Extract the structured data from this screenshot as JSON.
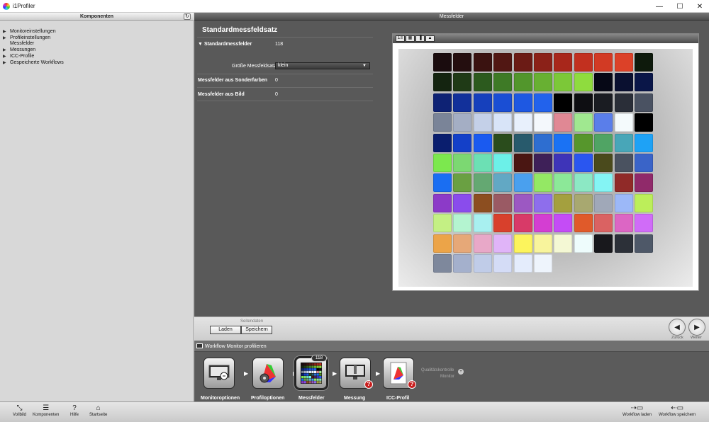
{
  "window": {
    "title": "i1Profiler",
    "minimize": "—",
    "maximize": "☐",
    "close": "✕"
  },
  "left_panel": {
    "header": "Komponenten",
    "refresh_glyph": "↻",
    "items": [
      {
        "label": "Monitoreinstellungen",
        "expandable": true
      },
      {
        "label": "Profileinstellungen",
        "expandable": true
      },
      {
        "label": "Messfelder",
        "expandable": false
      },
      {
        "label": "Messungen",
        "expandable": true
      },
      {
        "label": "ICC-Profile",
        "expandable": true
      },
      {
        "label": "Gespeicherte Workflows",
        "expandable": true
      }
    ]
  },
  "center": {
    "title": "Messfelder",
    "section_title": "Standardmessfeldsatz",
    "standard_label": "Standardmessfelder",
    "standard_value": "118",
    "size_label": "Größe Messfeldsatz:",
    "size_value": "klein",
    "spot_label": "Messfelder aus Sonderfarben",
    "spot_value": "0",
    "image_label": "Messfelder aus Bild",
    "image_value": "0"
  },
  "preview_toolbar": [
    "Σ≡",
    "▦",
    "▐",
    "▲"
  ],
  "patches": [
    "#1a0c0e",
    "#240e0f",
    "#3a1210",
    "#511713",
    "#6b1b15",
    "#8b2118",
    "#a8271b",
    "#c2301f",
    "#d23a24",
    "#dc4128",
    "#0e1a0c",
    "#142410",
    "#1f3a16",
    "#2c5a1e",
    "#3e7a26",
    "#52962c",
    "#68b032",
    "#7cc838",
    "#8fdc3e",
    "#060816",
    "#0a1030",
    "#0a1648",
    "#0e2274",
    "#12309a",
    "#1640bc",
    "#1a4ed4",
    "#1e58e2",
    "#2262ec",
    "#000000",
    "#0e0e12",
    "#1a1c22",
    "#2a2e38",
    "#4a5262",
    "#7a8498",
    "#a4aec4",
    "#c4d0e8",
    "#d8e4f8",
    "#e8f0fc",
    "#f4f8fc",
    "#e08894",
    "#a0e890",
    "#5a7eea",
    "#f4fafc",
    "#000000",
    "#0a1e6e",
    "#1440c8",
    "#1a5af0",
    "#2a4c1c",
    "#285a6c",
    "#2e6ed0",
    "#1a72f4",
    "#56962c",
    "#50a464",
    "#48a6b8",
    "#1ea2f6",
    "#7ce84e",
    "#7cd872",
    "#6ce0b4",
    "#6cf0e8",
    "#4a1612",
    "#3e2058",
    "#3e34b8",
    "#2a56f0",
    "#4a4a1c",
    "#4a5260",
    "#3a64c8",
    "#1a6ef2",
    "#6aa042",
    "#64a872",
    "#62a8c4",
    "#4aa0ee",
    "#94e864",
    "#8ce898",
    "#8ce8c4",
    "#84f4f4",
    "#902a28",
    "#902a6a",
    "#8c3ac8",
    "#8a4cec",
    "#8c4e20",
    "#9a5a64",
    "#9c58c2",
    "#8e6eec",
    "#a4a03e",
    "#a8a870",
    "#a0a8b8",
    "#9cb8f8",
    "#bcee5a",
    "#c4f084",
    "#b4f4d0",
    "#a8f0f0",
    "#d8402c",
    "#d83a68",
    "#d43ed2",
    "#c44cf6",
    "#e05a2a",
    "#da6262",
    "#dc66c4",
    "#d06cf8",
    "#eca448",
    "#e6a878",
    "#e8a8c8",
    "#e0b4f8",
    "#fcf45c",
    "#f8f49c",
    "#f4f8d4",
    "#eefcfc",
    "#18181c",
    "#2c3038",
    "#4e5868",
    "#7e889c",
    "#a4b0cc",
    "#c0cce8",
    "#d4dcf6",
    "#e4ecfc",
    "#eef4fc"
  ],
  "page_data": {
    "label": "Seitendaten",
    "load": "Laden",
    "save": "Speichern"
  },
  "nav": {
    "back_glyph": "◀",
    "back": "Zurück",
    "next_glyph": "▶",
    "next": "Weiter"
  },
  "workflow": {
    "title": "Workflow Monitor profilieren",
    "steps": [
      {
        "label": "Monitoroptionen"
      },
      {
        "label": "Profiloptionen"
      },
      {
        "label": "Messfelder",
        "badge": "118"
      },
      {
        "label": "Messung",
        "warn": "?"
      },
      {
        "label": "ICC-Profil",
        "warn": "?"
      }
    ],
    "qc_line1": "Qualitätskontrolle",
    "qc_line2": "Monitor"
  },
  "bottom": {
    "fullscreen": "Vollbild",
    "components": "Komponenten",
    "help": "Hilfe",
    "home": "Startseite",
    "help_glyph": "?",
    "load_workflow": "Workflow laden",
    "save_workflow": "Workflow speichern"
  }
}
